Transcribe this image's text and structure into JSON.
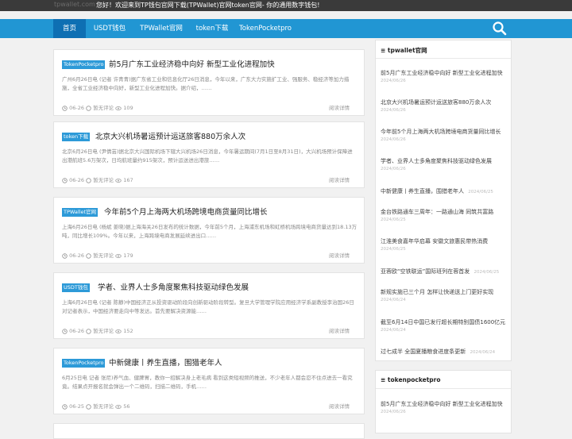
{
  "topbar": {
    "site_name": "tpwallet.com",
    "welcome": "您好！欢迎来到TP钱包官网下载(TPWallet)官网token官网- 你的通用数字钱包!"
  },
  "nav": {
    "items": [
      "首页",
      "USDT钱包",
      "TPWallet官网",
      "token下载",
      "TokenPocketpro"
    ],
    "active_index": 0
  },
  "icons": {
    "search": "search-icon",
    "clock": "clock-icon",
    "comment": "comment-icon",
    "eye": "eye-icon",
    "widget": "list-icon"
  },
  "colors": {
    "topbar": "#3a3a3a",
    "nav": "#2196d3",
    "nav_active": "#0e6fb3",
    "tag": "#2d9ad8"
  },
  "posts": [
    {
      "tag": "TokenPocketpro",
      "title": "前5月广东工业经济稳中向好 新型工业化进程加快",
      "excerpt": "广州6月26日电 (记者 许青青)据广东省工业和信息化厅26日消息，今年以来，广东大力实施扩工业、强服务、稳经济等加力措施，全省工业经济稳中向好，新型工业化进程加快。据介绍，……",
      "date": "06-26",
      "comments": "暂无评论",
      "views": "109",
      "more": "阅读详情"
    },
    {
      "tag": "token下载",
      "title": "北京大兴机场暑运预计运送旅客880万余人次",
      "excerpt": "北京6月26日电 (尹倩芸)据北京大兴国际机场下辖大兴机场26日消息，今年暑运期间(7月1日至8月31日)，大兴机场预计保障进出港航班5.6万架次，日均航班量约915架次，预计运送进出港旅……",
      "date": "06-26",
      "comments": "暂无评论",
      "views": "167",
      "more": "阅读详情"
    },
    {
      "tag": "TPWallet官网",
      "title": "今年前5个月上海两大机场跨境电商货量同比增长",
      "excerpt": "上海6月26日电 (杨斌 姜晓)据上海海关26日发布的统计数据，今年前5个月，上海浦东机场和虹桥机场跨境电商货量达到18.13万吨，同比增长109%。今年以来，上海跨境电商发展延续进出口……",
      "date": "06-26",
      "comments": "暂无评论",
      "views": "179",
      "more": "阅读详情"
    },
    {
      "tag": "USDT钱包",
      "title": "学者、业界人士多角度聚焦科技驱动绿色发展",
      "excerpt": "上海6月26日电 (记者 陈静)中国经济正从投资驱动阶段向创新驱动阶段转型。复旦大学管理学院应用经济学系副教授李治国26日对记者表示，中国经济要走向中等发达。首先要解决资源能……",
      "date": "06-26",
      "comments": "暂无评论",
      "views": "152",
      "more": "阅读详情"
    },
    {
      "tag": "TokenPocketpro",
      "title": "中新健康丨养生直播，围猎老年人",
      "excerpt": "6月25日电 记者 张尼)养气血、健脾胃，教你一招解决身上老毛病 看到这类短视频的推送，不少老年人都会忍不住点进去一看究竟。结果点开报名就会弹出一个二维码，扫描二维码，手机……",
      "date": "06-25",
      "comments": "暂无评论",
      "views": "56",
      "more": "阅读详情"
    }
  ],
  "sidebar": {
    "widget1": {
      "title": "tpwallet官网",
      "items": [
        {
          "title": "前5月广东工业经济稳中向好 新型工业化进程加快",
          "date": "2024/06/26"
        },
        {
          "title": "北京大兴机场暑运预计运送旅客880万余人次",
          "date": "2024/06/26"
        },
        {
          "title": "今年前5个月上海两大机场跨境电商货量同比增长",
          "date": "2024/06/26"
        },
        {
          "title": "学者、业界人士多角度聚焦科技驱动绿色发展",
          "date": "2024/06/26"
        },
        {
          "title": "中新健康丨养生直播，围猎老年人",
          "date": "2024/06/25"
        },
        {
          "title": "金台铁路通车三周年：一路通山海 同筑共富路",
          "date": "2024/06/25"
        },
        {
          "title": "江淮美食嘉年华启幕 安徽文旅惠民带热消费",
          "date": "2024/06/25"
        },
        {
          "title": "亚蓉欧“空铁联运”国际班列在蓉首发",
          "date": "2024/06/25"
        },
        {
          "title": "新规实施已三个月 怎样让快递送上门更好实现",
          "date": "2024/06/24"
        },
        {
          "title": "截至6月14日中国已发行超长期特别国债1600亿元",
          "date": "2024/06/24"
        },
        {
          "title": "过七成半 全国夏播粮食进度条更新",
          "date": "2024/06/24"
        }
      ]
    },
    "widget2": {
      "title": "tokenpocketpro",
      "items": [
        {
          "title": "前5月广东工业经济稳中向好 新型工业化进程加快",
          "date": "2024/06/26"
        }
      ]
    }
  }
}
